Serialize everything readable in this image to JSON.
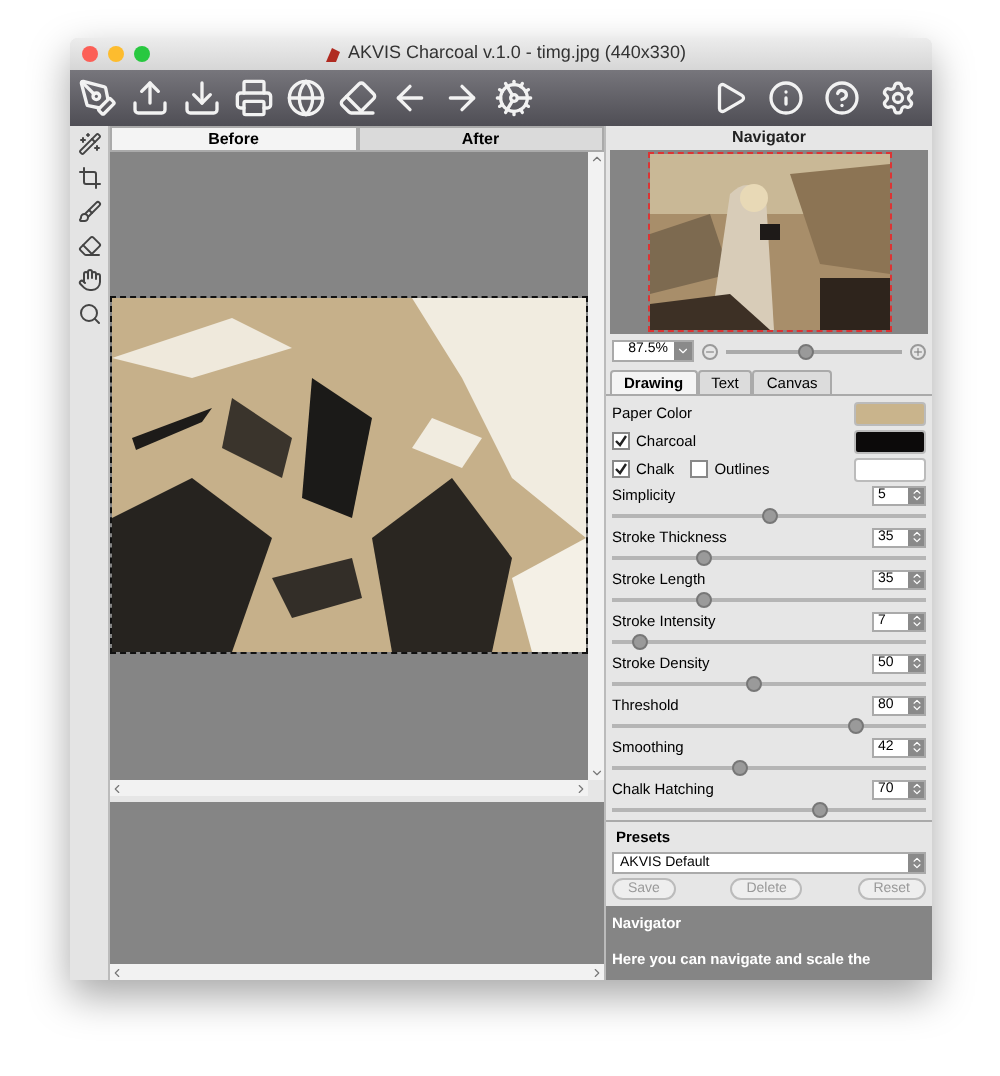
{
  "window": {
    "title": "AKVIS Charcoal v.1.0 - timg.jpg (440x330)"
  },
  "view_tabs": [
    {
      "label": "Before",
      "selected": true
    },
    {
      "label": "After",
      "selected": false
    }
  ],
  "navigator": {
    "title": "Navigator",
    "zoom": "87.5%",
    "level": 0.45
  },
  "settings_tabs": [
    {
      "label": "Drawing",
      "selected": true
    },
    {
      "label": "Text",
      "selected": false
    },
    {
      "label": "Canvas",
      "selected": false
    }
  ],
  "colors": [
    {
      "kind": "label",
      "label": "Paper Color",
      "color": "#c9b48c"
    },
    {
      "kind": "checkbox",
      "label": "Charcoal",
      "checked": true,
      "color": "#0c0a0a"
    },
    {
      "kind": "pair",
      "label": "Chalk",
      "checked": true,
      "label_2": "Outlines",
      "checked_2": false,
      "color": "#ffffff"
    }
  ],
  "sliders": [
    {
      "label": "Simplicity",
      "value": "5",
      "level": 0.5
    },
    {
      "label": "Stroke Thickness",
      "value": "35",
      "level": 0.29
    },
    {
      "label": "Stroke Length",
      "value": "35",
      "level": 0.29
    },
    {
      "label": "Stroke Intensity",
      "value": "7",
      "level": 0.09
    },
    {
      "label": "Stroke Density",
      "value": "50",
      "level": 0.45
    },
    {
      "label": "Threshold",
      "value": "80",
      "level": 0.78
    },
    {
      "label": "Smoothing",
      "value": "42",
      "level": 0.41
    },
    {
      "label": "Chalk Hatching",
      "value": "70",
      "level": 0.66
    }
  ],
  "presets": {
    "title": "Presets",
    "selected": "AKVIS Default",
    "buttons": [
      {
        "label": "Save",
        "disabled": true
      },
      {
        "label": "Delete",
        "disabled": true
      },
      {
        "label": "Reset",
        "disabled": true
      }
    ]
  },
  "help": {
    "title": "Navigator",
    "text": "Here you can navigate and scale the"
  }
}
